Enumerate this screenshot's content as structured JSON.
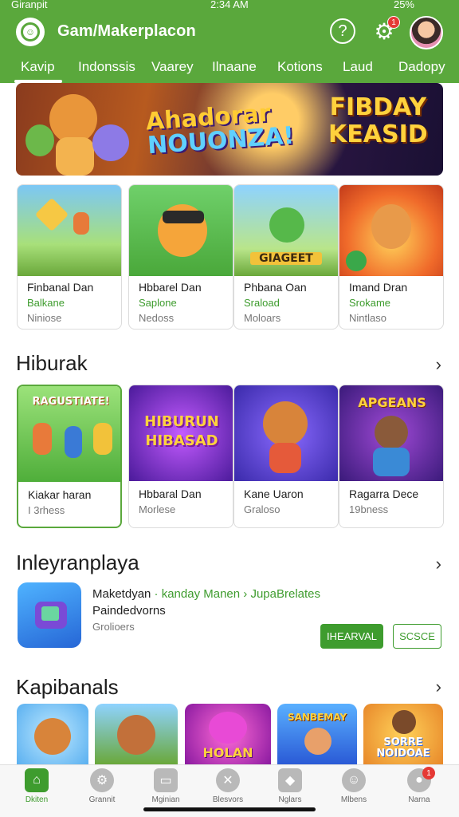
{
  "status": {
    "left": "Giranpit",
    "time": "2:34 AM",
    "battery": "25%"
  },
  "header": {
    "title": "Gam/Makerplacon",
    "notif_count": "1"
  },
  "tabs": [
    "Kavip",
    "Indonssis",
    "Vaarey",
    "Ilnaane",
    "Kotions",
    "Laud",
    "Dadopy"
  ],
  "banner": {
    "left_line1": "Ahadorar",
    "left_line2": "NOUONZA!",
    "right_line1": "FIBDAY",
    "right_line2": "KEASID"
  },
  "featured_cards": [
    {
      "name": "Finbanal Dan",
      "sub": "Balkane",
      "meta": "Niniose"
    },
    {
      "name": "Hbbarel Dan",
      "sub": "Saplone",
      "meta": "Nedoss"
    },
    {
      "name": "Phbana Oan",
      "sub": "Sraload",
      "meta": "Moloars",
      "thumb_text": "GIAGEET"
    },
    {
      "name": "Imand Dran",
      "sub": "Srokame",
      "meta": "Nintlaso"
    }
  ],
  "section1": {
    "title": "Hiburak"
  },
  "section1_cards": [
    {
      "name": "Kiakar haran",
      "meta": "I 3rhess",
      "thumb_text": "RAGUSTIATE!"
    },
    {
      "name": "Hbbaral Dan",
      "meta": "Morlese",
      "thumb_text1": "HIBURUN",
      "thumb_text2": "HIBASAD"
    },
    {
      "name": "Kane Uaron",
      "meta": "Graloso"
    },
    {
      "name": "Ragarra Dece",
      "meta": "19bness",
      "thumb_text": "APGEANS"
    }
  ],
  "section2": {
    "title": "Inleyranplaya"
  },
  "featured_row": {
    "title": "Maketdyan",
    "tag1": "kanday Manen",
    "tag2": "JupaBrelates",
    "subtitle": "Paindedvorns",
    "meta": "Grolioers",
    "primary_button": "IHEARVAL",
    "secondary_button": "SCSCE"
  },
  "section3": {
    "title": "Kapibanals"
  },
  "strip": [
    {
      "thumb_text": ""
    },
    {
      "thumb_text": ""
    },
    {
      "thumb_text": "HOLAN"
    },
    {
      "thumb_text": "SANBEMAY"
    },
    {
      "thumb_text1": "SORRE",
      "thumb_text2": "NOIDOAE"
    }
  ],
  "bottom_nav": [
    {
      "label": "Dkiten",
      "icon": "home-icon"
    },
    {
      "label": "Grannit",
      "icon": "gear-icon"
    },
    {
      "label": "Mginian",
      "icon": "card-icon"
    },
    {
      "label": "Blesvors",
      "icon": "x-circle-icon"
    },
    {
      "label": "Nglars",
      "icon": "tag-icon"
    },
    {
      "label": "Mlbens",
      "icon": "face-icon"
    },
    {
      "label": "Narna",
      "icon": "person-icon",
      "badge": "1"
    }
  ],
  "colors": {
    "primary": "#5aa83c",
    "accent": "#3e9c2e",
    "badge": "#e53935"
  }
}
